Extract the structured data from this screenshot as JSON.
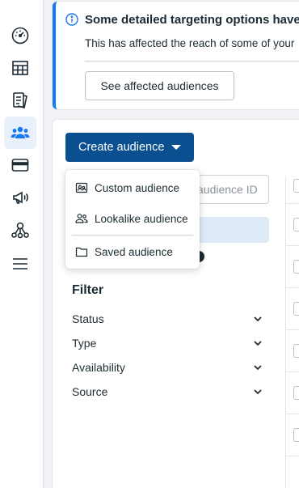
{
  "banner": {
    "title": "Some detailed targeting options have",
    "text": "This has affected the reach of some of your",
    "button_label": "See affected audiences"
  },
  "toolbar": {
    "create_label": "Create audience"
  },
  "search": {
    "placeholder": "audience ID"
  },
  "dropdown": {
    "items": [
      {
        "label": "Custom audience",
        "icon": "custom-audience-icon"
      },
      {
        "label": "Lookalike audience",
        "icon": "lookalike-audience-icon"
      },
      {
        "label": "Saved audience",
        "icon": "folder-icon"
      }
    ]
  },
  "filter": {
    "title": "Filter",
    "items": [
      {
        "label": "Status"
      },
      {
        "label": "Type"
      },
      {
        "label": "Availability"
      },
      {
        "label": "Source"
      }
    ]
  },
  "sidebar": {
    "items": [
      {
        "icon": "dashboard-gauge-icon",
        "active": false
      },
      {
        "icon": "table-grid-icon",
        "active": false
      },
      {
        "icon": "pages-icon",
        "active": false
      },
      {
        "icon": "audiences-icon",
        "active": true
      },
      {
        "icon": "billing-card-icon",
        "active": false
      },
      {
        "icon": "megaphone-icon",
        "active": false
      },
      {
        "icon": "network-icon",
        "active": false
      },
      {
        "icon": "menu-icon",
        "active": false
      }
    ]
  },
  "colors": {
    "primary_button": "#0a4f8f",
    "accent": "#1877f2",
    "active_nav_bg": "#e7f0fb"
  }
}
